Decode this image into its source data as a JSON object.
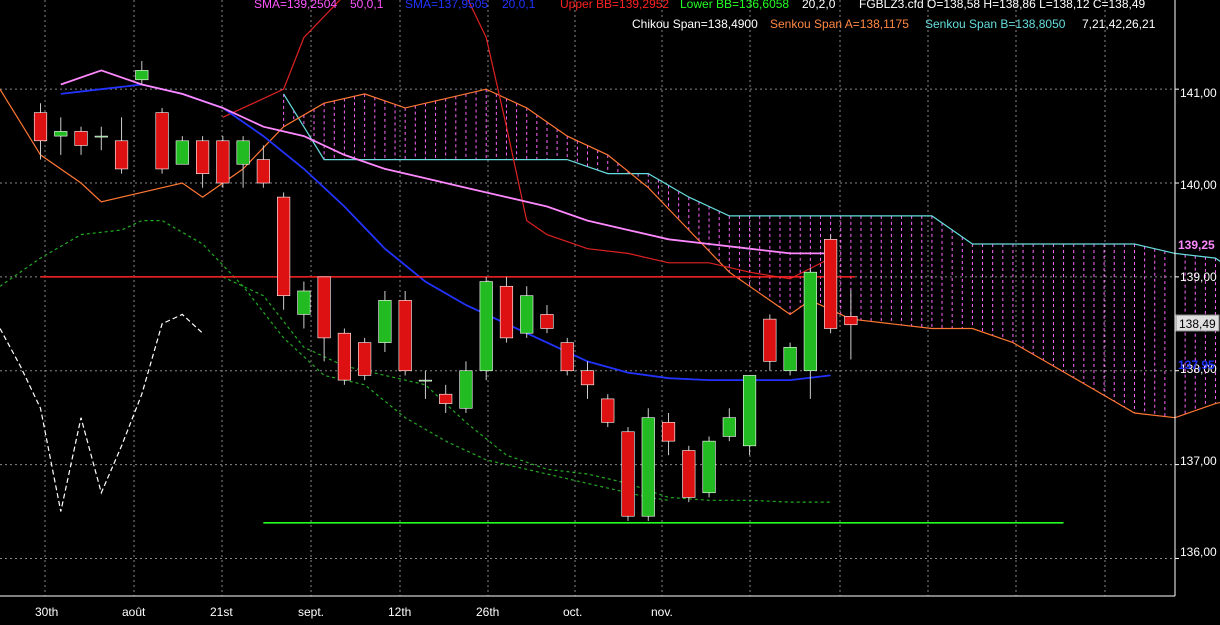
{
  "chart_data": {
    "type": "candlestick",
    "instrument_header": "FGBLZ3.cfd O=138,58 H=138,86 L=138,12 C=138,49",
    "legend_items": [
      {
        "text": "SMA=139,2504",
        "color": "#ff55ff"
      },
      {
        "text": "50,0,1",
        "color": "#ff55ff"
      },
      {
        "text": "SMA=137,9505",
        "color": "#2233ff"
      },
      {
        "text": "20,0,1",
        "color": "#2233ff"
      },
      {
        "text": "Upper BB=139,2952",
        "color": "#ff2222"
      },
      {
        "text": "Lower BB=136,6058",
        "color": "#22ff22"
      },
      {
        "text": "20,2,0",
        "color": "#ffffff"
      }
    ],
    "ichimoku_items": [
      {
        "text": "Chikou Span=138,4900",
        "color": "#ffffff"
      },
      {
        "text": "Senkou Span A=138,1175",
        "color": "#ff8844"
      },
      {
        "text": "Senkou Span B=138,8050",
        "color": "#66dddd"
      },
      {
        "text": "7,21,42,26,21",
        "color": "#ffffff"
      }
    ],
    "y_ticks": [
      "141,00",
      "140,00",
      "139,00",
      "138,00",
      "137,00",
      "136,00"
    ],
    "x_ticks": [
      "30th",
      "août",
      "21st",
      "sept.",
      "12th",
      "26th",
      "oct.",
      "nov."
    ],
    "last_price_label": "138,49",
    "sma50_label": "139,25",
    "sma20_label": "137,95",
    "ylim": [
      135.6,
      141.95
    ],
    "x_slots": [
      -2,
      56
    ],
    "candles": [
      [
        140.75,
        140.45,
        140.85,
        140.25
      ],
      [
        140.5,
        140.55,
        140.7,
        140.3
      ],
      [
        140.55,
        140.4,
        140.6,
        140.3
      ],
      [
        140.5,
        140.5,
        140.6,
        140.35
      ],
      [
        140.45,
        140.15,
        140.7,
        140.1
      ],
      [
        141.1,
        141.2,
        141.3,
        141.05
      ],
      [
        140.75,
        140.15,
        140.8,
        140.1
      ],
      [
        140.2,
        140.45,
        140.5,
        140.2
      ],
      [
        140.45,
        140.1,
        140.5,
        139.95
      ],
      [
        140.45,
        140.0,
        140.5,
        139.95
      ],
      [
        140.2,
        140.45,
        140.5,
        139.95
      ],
      [
        140.25,
        140.0,
        140.4,
        139.95
      ],
      [
        139.85,
        138.8,
        139.9,
        138.65
      ],
      [
        138.6,
        138.85,
        138.95,
        138.45
      ],
      [
        139.0,
        138.35,
        139.0,
        138.1
      ],
      [
        138.4,
        137.9,
        138.45,
        137.85
      ],
      [
        138.3,
        137.95,
        138.35,
        137.9
      ],
      [
        138.3,
        138.75,
        138.85,
        138.2
      ],
      [
        138.75,
        138.0,
        138.85,
        137.95
      ],
      [
        137.9,
        137.9,
        138.0,
        137.7
      ],
      [
        137.75,
        137.65,
        137.85,
        137.55
      ],
      [
        137.6,
        138.0,
        138.1,
        137.55
      ],
      [
        138.0,
        138.95,
        139.0,
        137.9
      ],
      [
        138.9,
        138.35,
        139.0,
        138.3
      ],
      [
        138.4,
        138.8,
        138.9,
        138.35
      ],
      [
        138.6,
        138.45,
        138.7,
        138.4
      ],
      [
        138.3,
        138.0,
        138.35,
        137.95
      ],
      [
        138.0,
        137.85,
        138.1,
        137.7
      ],
      [
        137.7,
        137.45,
        137.75,
        137.4
      ],
      [
        137.35,
        136.45,
        137.4,
        136.4
      ],
      [
        136.45,
        137.5,
        137.6,
        136.4
      ],
      [
        137.45,
        137.25,
        137.55,
        137.1
      ],
      [
        137.15,
        136.65,
        137.2,
        136.6
      ],
      [
        136.7,
        137.25,
        137.3,
        136.65
      ],
      [
        137.3,
        137.5,
        137.6,
        137.25
      ],
      [
        137.2,
        137.95,
        137.95,
        137.1
      ],
      [
        138.55,
        138.1,
        138.6,
        138.0
      ],
      [
        138.0,
        138.25,
        138.3,
        137.95
      ],
      [
        138.0,
        139.05,
        139.1,
        137.7
      ],
      [
        139.4,
        138.45,
        139.45,
        138.4
      ],
      [
        138.58,
        138.49,
        138.86,
        138.12
      ]
    ],
    "sma50": [
      [
        1,
        141.05
      ],
      [
        3,
        141.2
      ],
      [
        5,
        141.05
      ],
      [
        7,
        140.95
      ],
      [
        9,
        140.8
      ],
      [
        11,
        140.6
      ],
      [
        13,
        140.5
      ],
      [
        15,
        140.3
      ],
      [
        17,
        140.15
      ],
      [
        19,
        140.05
      ],
      [
        21,
        139.95
      ],
      [
        23,
        139.85
      ],
      [
        25,
        139.75
      ],
      [
        27,
        139.6
      ],
      [
        29,
        139.5
      ],
      [
        31,
        139.4
      ],
      [
        33,
        139.35
      ],
      [
        35,
        139.3
      ],
      [
        37,
        139.25
      ],
      [
        39,
        139.25
      ]
    ],
    "sma20": [
      [
        1,
        140.95
      ],
      [
        3,
        141.0
      ],
      [
        5,
        141.05
      ],
      [
        7,
        140.95
      ],
      [
        9,
        140.8
      ],
      [
        11,
        140.5
      ],
      [
        13,
        140.15
      ],
      [
        15,
        139.75
      ],
      [
        17,
        139.3
      ],
      [
        19,
        138.95
      ],
      [
        21,
        138.7
      ],
      [
        23,
        138.5
      ],
      [
        25,
        138.3
      ],
      [
        27,
        138.1
      ],
      [
        29,
        137.98
      ],
      [
        31,
        137.92
      ],
      [
        33,
        137.9
      ],
      [
        35,
        137.9
      ],
      [
        37,
        137.9
      ],
      [
        39,
        137.95
      ]
    ],
    "upper_bb": [
      [
        9,
        140.7
      ],
      [
        11,
        140.9
      ],
      [
        12,
        141.0
      ],
      [
        13,
        141.55
      ],
      [
        15,
        142.0
      ],
      [
        17,
        142.0
      ],
      [
        19,
        142.0
      ],
      [
        21,
        142.0
      ],
      [
        22,
        141.55
      ],
      [
        23,
        140.6
      ],
      [
        24,
        139.6
      ],
      [
        25,
        139.45
      ],
      [
        27,
        139.3
      ],
      [
        29,
        139.25
      ],
      [
        31,
        139.15
      ],
      [
        33,
        139.15
      ],
      [
        35,
        139.05
      ],
      [
        37,
        138.98
      ],
      [
        39,
        139.2
      ]
    ],
    "lower_bb": [
      [
        9,
        139.0
      ],
      [
        11,
        138.8
      ],
      [
        13,
        138.25
      ],
      [
        15,
        138.05
      ],
      [
        17,
        137.95
      ],
      [
        19,
        137.85
      ],
      [
        21,
        137.45
      ],
      [
        23,
        137.1
      ],
      [
        25,
        136.95
      ],
      [
        27,
        136.9
      ],
      [
        29,
        136.8
      ],
      [
        31,
        136.65
      ],
      [
        33,
        136.62
      ],
      [
        35,
        136.62
      ],
      [
        37,
        136.6
      ],
      [
        39,
        136.6
      ]
    ],
    "chikou": [
      [
        -2,
        138.45
      ],
      [
        -1,
        138.05
      ],
      [
        0,
        137.6
      ],
      [
        1,
        136.5
      ],
      [
        2,
        137.5
      ],
      [
        3,
        136.7
      ],
      [
        4,
        137.2
      ],
      [
        5,
        137.75
      ],
      [
        6,
        138.5
      ],
      [
        7,
        138.6
      ],
      [
        8,
        138.4
      ]
    ],
    "tenkan": [
      [
        -2,
        138.9
      ],
      [
        0,
        139.2
      ],
      [
        2,
        139.45
      ],
      [
        4,
        139.5
      ],
      [
        5,
        139.6
      ],
      [
        6,
        139.6
      ],
      [
        8,
        139.35
      ],
      [
        10,
        138.9
      ],
      [
        12,
        138.35
      ],
      [
        14,
        137.95
      ],
      [
        16,
        137.85
      ],
      [
        18,
        137.5
      ],
      [
        20,
        137.25
      ],
      [
        22,
        137.05
      ],
      [
        24,
        136.95
      ],
      [
        26,
        136.85
      ],
      [
        28,
        136.75
      ],
      [
        30,
        136.65
      ],
      [
        31,
        136.62
      ]
    ],
    "senkou_a": [
      [
        -2,
        141.0
      ],
      [
        0,
        140.3
      ],
      [
        2,
        140.0
      ],
      [
        3,
        139.8
      ],
      [
        5,
        139.9
      ],
      [
        7,
        140.0
      ],
      [
        8,
        139.85
      ],
      [
        10,
        140.15
      ],
      [
        12,
        140.6
      ],
      [
        14,
        140.85
      ],
      [
        16,
        140.95
      ],
      [
        18,
        140.8
      ],
      [
        20,
        140.9
      ],
      [
        22,
        141.0
      ],
      [
        24,
        140.8
      ],
      [
        26,
        140.5
      ],
      [
        28,
        140.3
      ],
      [
        30,
        139.95
      ],
      [
        32,
        139.5
      ],
      [
        34,
        139.05
      ],
      [
        36,
        138.75
      ],
      [
        37,
        138.6
      ],
      [
        38,
        138.75
      ],
      [
        40,
        138.55
      ],
      [
        42,
        138.5
      ],
      [
        44,
        138.45
      ],
      [
        46,
        138.45
      ],
      [
        48,
        138.3
      ],
      [
        50,
        138.05
      ],
      [
        52,
        137.8
      ],
      [
        54,
        137.55
      ],
      [
        56,
        137.5
      ],
      [
        58,
        137.65
      ],
      [
        60,
        137.75
      ],
      [
        62,
        138.0
      ],
      [
        63,
        138.15
      ]
    ],
    "senkou_b": [
      [
        12,
        140.95
      ],
      [
        14,
        140.25
      ],
      [
        16,
        140.25
      ],
      [
        18,
        140.25
      ],
      [
        20,
        140.25
      ],
      [
        22,
        140.25
      ],
      [
        24,
        140.25
      ],
      [
        26,
        140.25
      ],
      [
        28,
        140.1
      ],
      [
        30,
        140.1
      ],
      [
        32,
        139.85
      ],
      [
        34,
        139.65
      ],
      [
        36,
        139.65
      ],
      [
        38,
        139.65
      ],
      [
        40,
        139.65
      ],
      [
        42,
        139.65
      ],
      [
        44,
        139.65
      ],
      [
        46,
        139.35
      ],
      [
        48,
        139.35
      ],
      [
        50,
        139.35
      ],
      [
        52,
        139.35
      ],
      [
        54,
        139.35
      ],
      [
        56,
        139.25
      ],
      [
        58,
        139.2
      ],
      [
        60,
        138.9
      ],
      [
        62,
        138.65
      ]
    ],
    "hline_red": 139.0,
    "hline_green": 136.38,
    "colors": {
      "bull": "#22bb22",
      "bear": "#dd1111",
      "sma50": "#ff88ff",
      "sma20": "#2233ff",
      "upper_bb": "#dd2222",
      "lower_bb": "#22aa22",
      "chikou": "#ffffff",
      "senkou_a": "#ff7733",
      "senkou_b": "#66dddd",
      "tenkan": "#ff7733",
      "cloud": "#ff66ff",
      "grid": "#888888",
      "hline_red": "#ff2222",
      "hline_green": "#22ff22"
    }
  }
}
